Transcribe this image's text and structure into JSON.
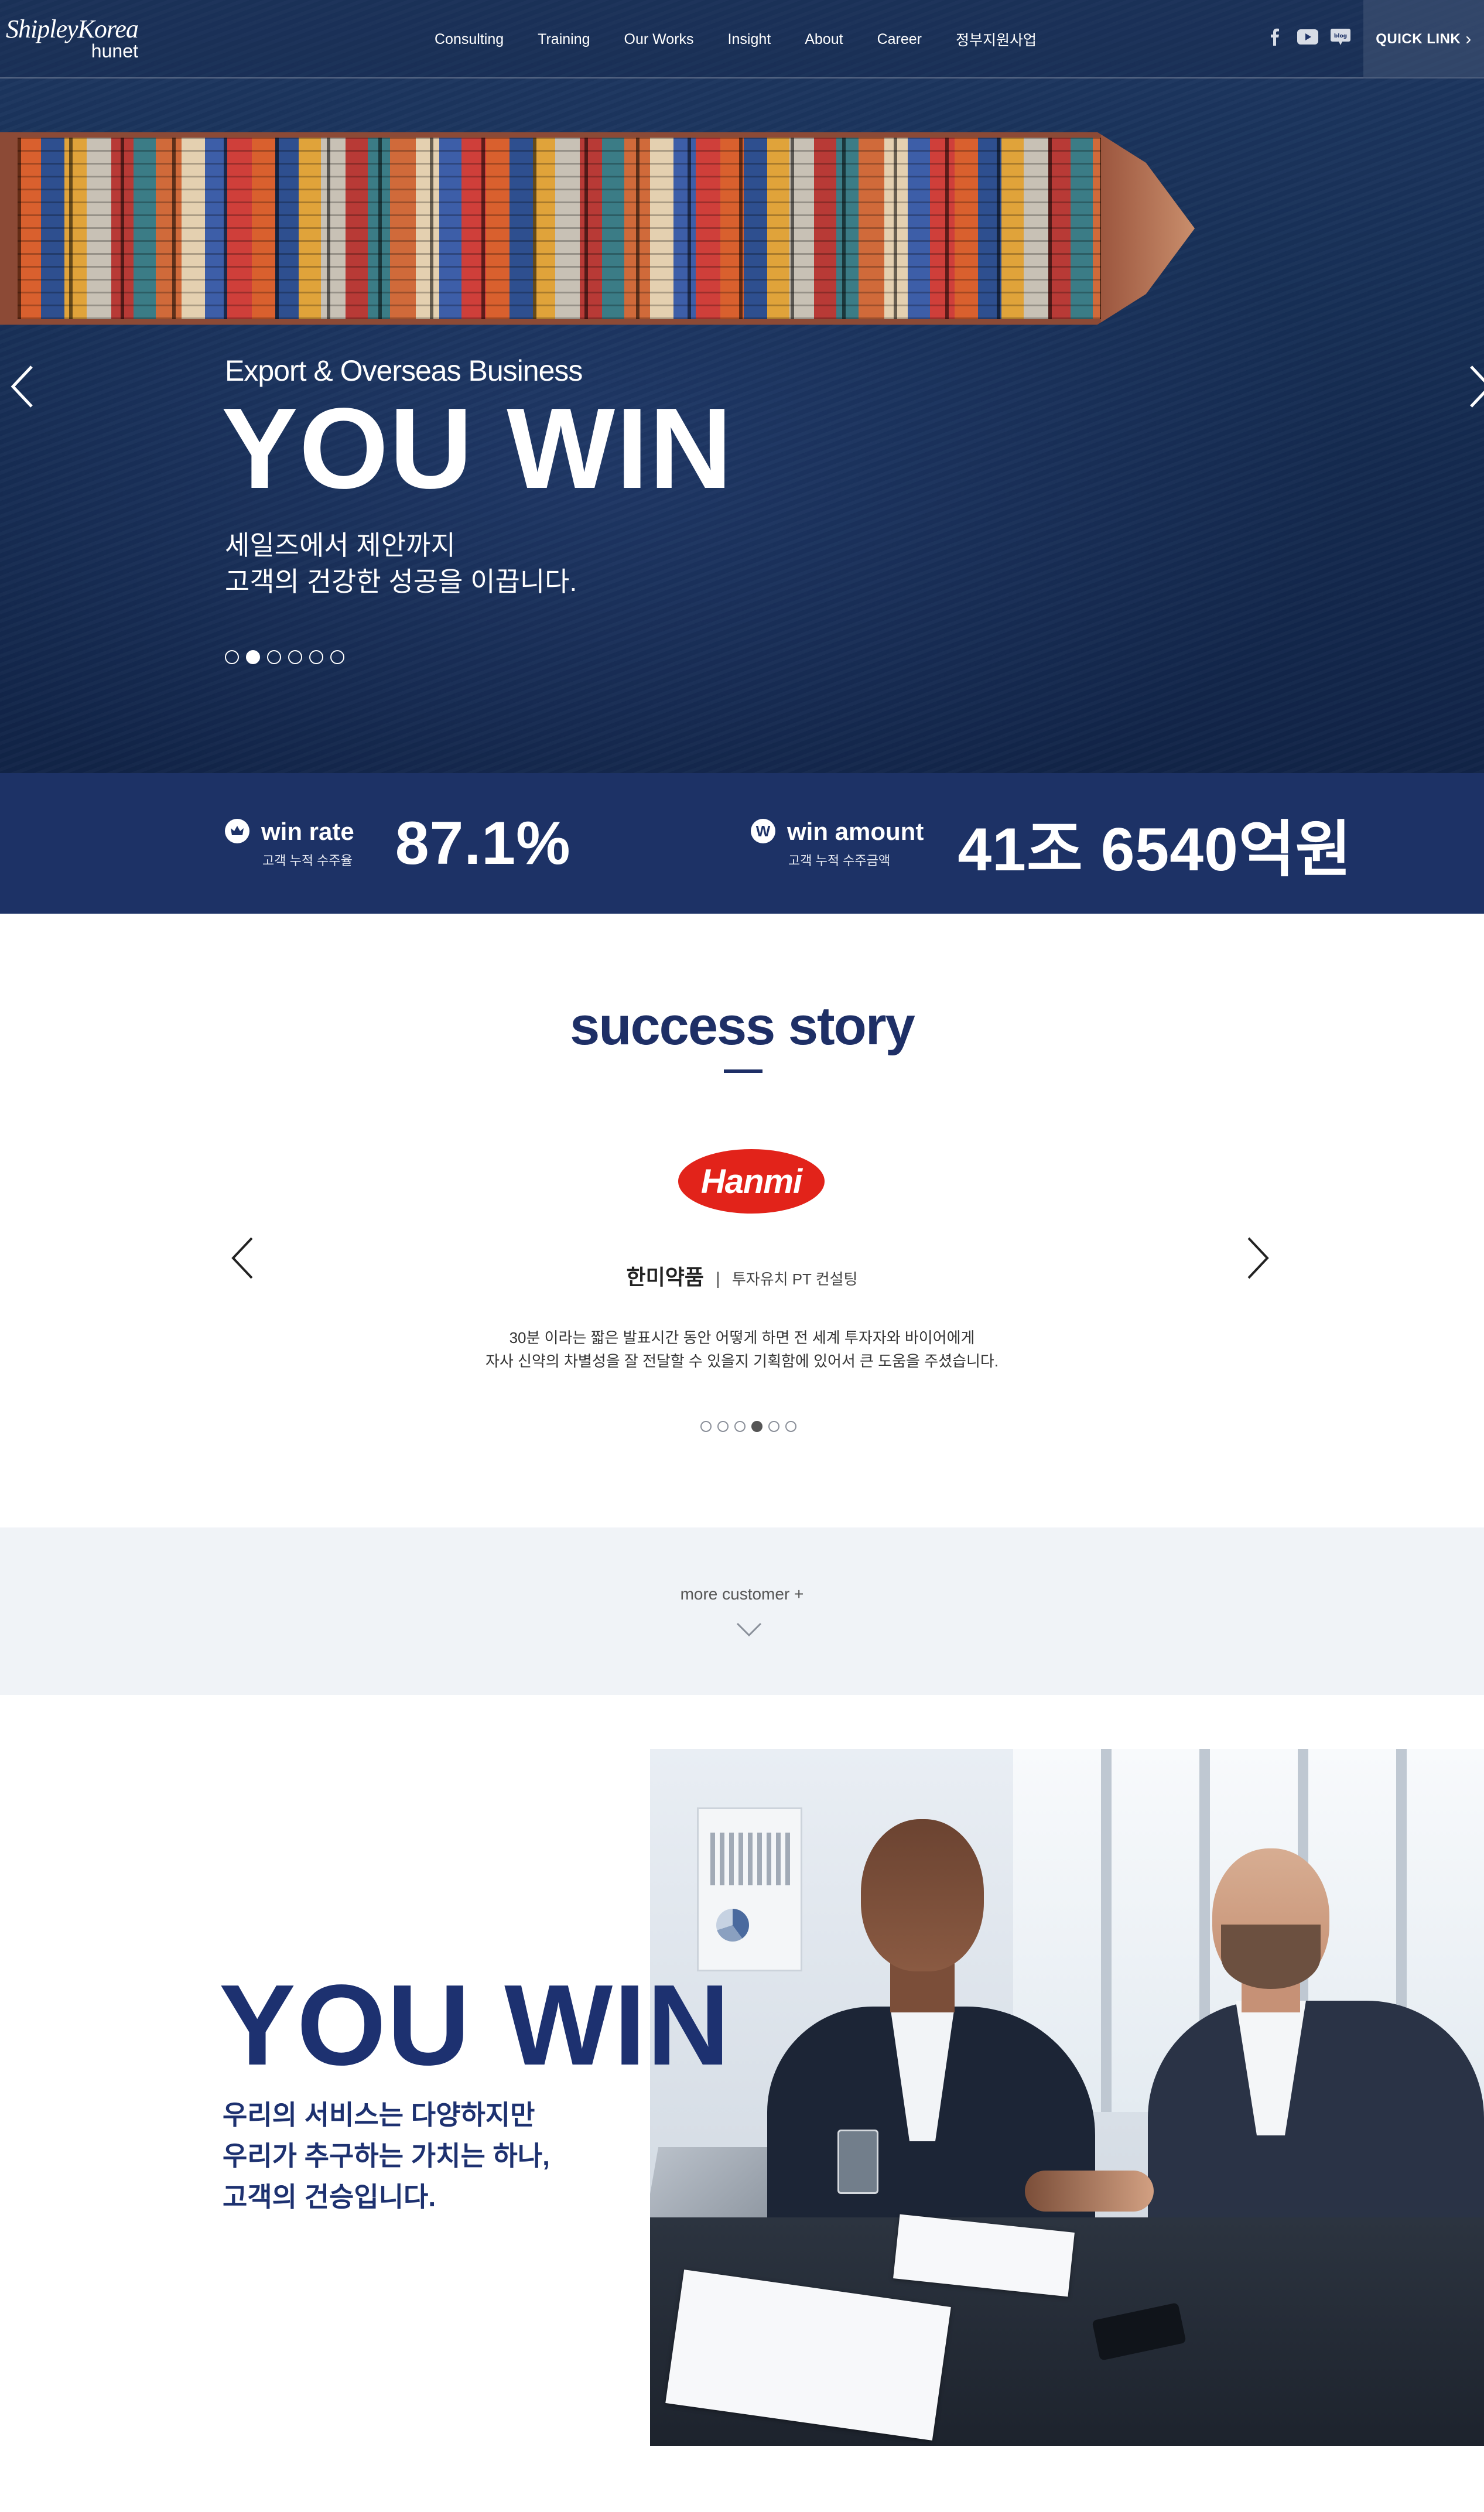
{
  "header": {
    "logo_top": "ShipleyKorea",
    "logo_bottom": "hunet",
    "nav": [
      "Consulting",
      "Training",
      "Our Works",
      "Insight",
      "About",
      "Career",
      "정부지원사업"
    ],
    "social_icons": [
      "facebook-icon",
      "youtube-icon",
      "blog-icon"
    ],
    "quick_link": "QUICK LINK"
  },
  "hero": {
    "subtitle": "Export & Overseas Business",
    "title": "YOU WIN",
    "desc_line1": "세일즈에서 제안까지",
    "desc_line2": "고객의 건강한 성공을 이끕니다.",
    "dots_total": 6,
    "dots_active_index": 1
  },
  "stats": {
    "win_rate": {
      "label": "win rate",
      "sublabel": "고객 누적 수주율",
      "value": "87.1%"
    },
    "win_amount": {
      "label": "win amount",
      "sublabel": "고객 누적 수주금액",
      "value": "41조 6540억원"
    }
  },
  "success_story": {
    "title": "success story",
    "logo_text": "Hanmi",
    "company": "한미약품",
    "separator": "|",
    "service": "투자유치 PT 컨설팅",
    "desc_line1": "30분 이라는 짧은 발표시간 동안 어떻게 하면 전 세계 투자자와 바이어에게",
    "desc_line2": "자사 신약의 차별성을 잘 전달할 수 있을지 기획함에 있어서 큰 도움을 주셨습니다.",
    "dots_total": 6,
    "dots_active_index": 3
  },
  "more": {
    "label": "more customer +"
  },
  "bottom": {
    "title": "YOU WIN",
    "desc_line1": "우리의 서비스는 다양하지만",
    "desc_line2": "우리가 추구하는 가치는 하나,",
    "desc_line3": "고객의 건승입니다."
  },
  "colors": {
    "navy": "#1d3266",
    "title_navy": "#1e2f66",
    "hanmi_red": "#e2231a",
    "more_bg": "#f0f3f7"
  }
}
